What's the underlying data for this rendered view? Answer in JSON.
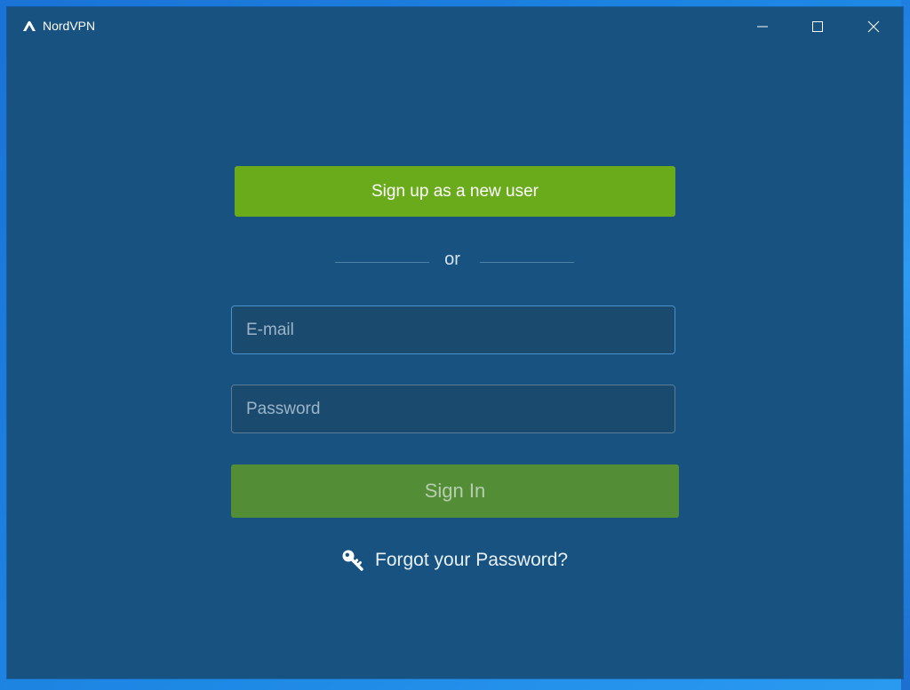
{
  "app": {
    "title": "NordVPN",
    "icon": "nordvpn-logo"
  },
  "window_controls": {
    "minimize_icon": "minimize-icon",
    "maximize_icon": "maximize-icon",
    "close_icon": "close-icon"
  },
  "login": {
    "signup_label": "Sign up as a new user",
    "divider_text": "or",
    "email": {
      "placeholder": "E-mail",
      "value": ""
    },
    "password": {
      "placeholder": "Password",
      "value": ""
    },
    "signin_label": "Sign In",
    "forgot_label": "Forgot your Password?",
    "forgot_icon": "key-icon"
  },
  "colors": {
    "window_background": "#175280",
    "signup_button": "#6aab1c",
    "signin_button": "#538e36",
    "field_background": "#1b4a6f",
    "field_focus_border": "#4a93cf",
    "desktop_background": "#1e88e5"
  }
}
